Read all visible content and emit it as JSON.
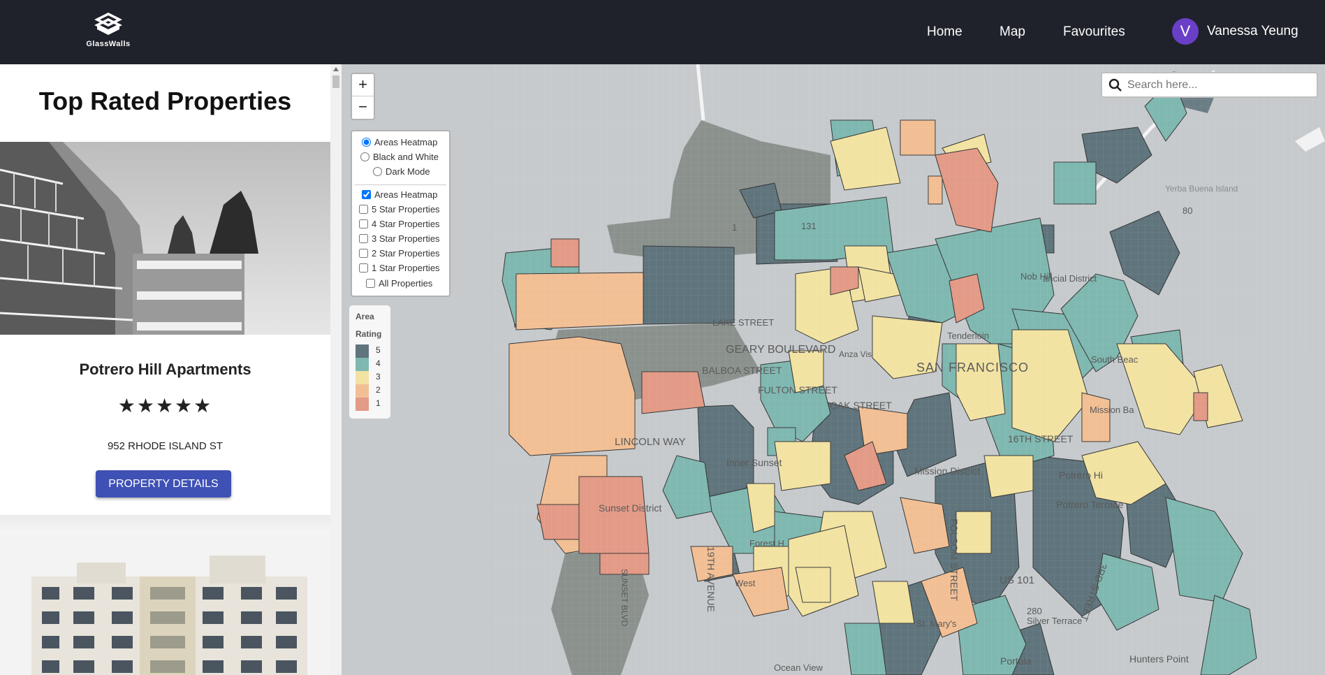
{
  "brand": {
    "name": "GlassWalls"
  },
  "nav": {
    "home": "Home",
    "map": "Map",
    "favourites": "Favourites"
  },
  "user": {
    "initial": "V",
    "name": "Vanessa Yeung"
  },
  "sidebar": {
    "title": "Top Rated Properties",
    "cards": [
      {
        "name": "Potrero Hill Apartments",
        "stars": "★★★★★",
        "rating": 5,
        "address": "952 RHODE ISLAND ST",
        "button": "PROPERTY DETAILS"
      }
    ]
  },
  "map": {
    "zoom_in": "+",
    "zoom_out": "−",
    "search_placeholder": "Search here...",
    "base_layers": [
      {
        "label": "Areas Heatmap",
        "checked": true
      },
      {
        "label": "Black and White",
        "checked": false
      },
      {
        "label": "Dark Mode",
        "checked": false
      }
    ],
    "overlays": [
      {
        "label": "Areas Heatmap",
        "checked": true
      },
      {
        "label": "5 Star Properties",
        "checked": false
      },
      {
        "label": "4 Star Properties",
        "checked": false
      },
      {
        "label": "3 Star Properties",
        "checked": false
      },
      {
        "label": "2 Star Properties",
        "checked": false
      },
      {
        "label": "1 Star Properties",
        "checked": false
      },
      {
        "label": "All Properties",
        "checked": false
      }
    ],
    "legend": {
      "title_line1": "Area",
      "title_line2": "Rating",
      "items": [
        {
          "label": "5",
          "color": "#5f747c"
        },
        {
          "label": "4",
          "color": "#7fb8b0"
        },
        {
          "label": "3",
          "color": "#f2e3a2"
        },
        {
          "label": "2",
          "color": "#f2bf94"
        },
        {
          "label": "1",
          "color": "#e39a86"
        }
      ]
    },
    "labels": {
      "sf": "SAN FRANCISCO",
      "geary": "GEARY BOULEVARD",
      "balboa": "BALBOA STREET",
      "fulton": "FULTON STREET",
      "lincoln": "LINCOLN WAY",
      "sunset": "Sunset District",
      "inner_sunset": "Inner Sunset",
      "mission": "Mission District",
      "potrero_terrace": "Potrero Terrace",
      "potrero_hill": "Potrero Hi",
      "yerba": "Yerba Buena Island",
      "nob": "Nob Hill",
      "route80": "80",
      "route131": "131",
      "route1": "1",
      "us101": "US 101",
      "portola": "Portola",
      "hunters": "Hunters Point",
      "oak": "OAK STREET",
      "lake": "LAKE STREET",
      "sixteenth": "16TH STREET",
      "folsom": "FOLSOM STREET",
      "third": "3RD STREET",
      "nineteenth": "19TH AVENUE",
      "sunset_blvd": "SUNSET BLVD",
      "financial": "ancial District",
      "tenderloin": "Tenderloin",
      "anza": "Anza Vis",
      "mission_bay": "Mission Ba",
      "south_beach": "South Beac",
      "silver": "Silver Terrace",
      "ocean": "Ocean View",
      "st_marys": "St. Mary's",
      "forest": "Forest H",
      "west": "West",
      "route280": "280"
    }
  }
}
